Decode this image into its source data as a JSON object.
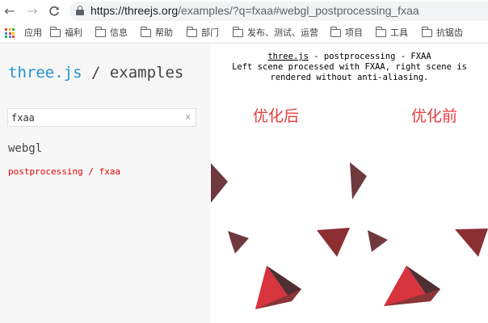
{
  "browser": {
    "url_host": "https://threejs.org",
    "url_path": "/examples/?q=fxaa#webgl_postprocessing_fxaa",
    "back_icon": "arrow-left-icon",
    "forward_icon": "arrow-right-icon",
    "reload_icon": "reload-icon",
    "lock_icon": "lock-icon"
  },
  "bookmarks": [
    {
      "label": "应用",
      "icon": "apps-grid-icon"
    },
    {
      "label": "福利",
      "icon": "folder-icon"
    },
    {
      "label": "信息",
      "icon": "folder-icon"
    },
    {
      "label": "帮助",
      "icon": "folder-icon"
    },
    {
      "label": "部门",
      "icon": "folder-icon"
    },
    {
      "label": "发布、测试、运营",
      "icon": "folder-icon"
    },
    {
      "label": "项目",
      "icon": "folder-icon"
    },
    {
      "label": "工具",
      "icon": "folder-icon"
    },
    {
      "label": "抗锯齿",
      "icon": "folder-icon"
    }
  ],
  "sidebar": {
    "brand_primary": "three.js",
    "brand_secondary": " / examples",
    "search_value": "fxaa",
    "clear_label": "x",
    "category": "webgl",
    "link": "postprocessing / fxaa"
  },
  "info": {
    "title_link": "three.js",
    "title_rest": " - postprocessing - FXAA",
    "line2": "Left scene processed with FXAA, right scene is",
    "line3": "rendered without anti-aliasing."
  },
  "annotations": {
    "left": "优化后",
    "right": "优化前"
  },
  "colors": {
    "accent_red": "#e43b3b",
    "link_red": "#e00000",
    "brand_blue": "#2194ce",
    "shape_dark": "#6e3a3d",
    "shape_red": "#d8343d"
  }
}
